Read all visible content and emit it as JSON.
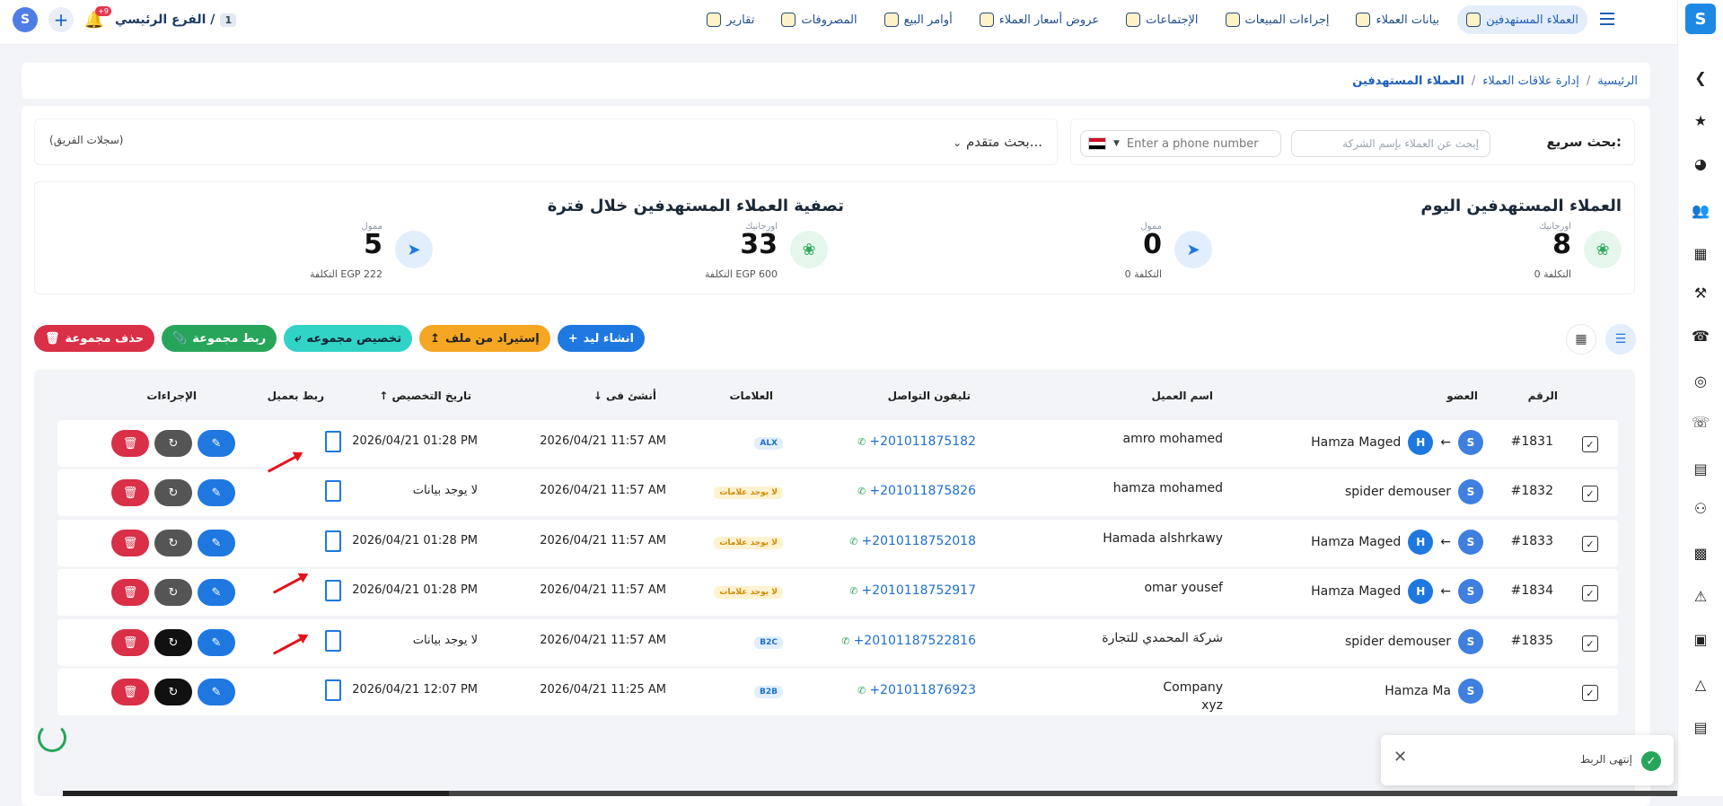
{
  "nav": {
    "items": [
      {
        "label": "العملاء المستهدفين",
        "icon": "target-users-icon",
        "active": true
      },
      {
        "label": "بيانات العملاء",
        "icon": "user-badge-icon"
      },
      {
        "label": "إجراءات المبيعات",
        "icon": "phone-icon"
      },
      {
        "label": "الإجتماعات",
        "icon": "presentation-icon"
      },
      {
        "label": "عروض أسعار العملاء",
        "icon": "document-icon"
      },
      {
        "label": "أوامر البيع",
        "icon": "money-bag-icon"
      },
      {
        "label": "المصروفات",
        "icon": "monitor-icon"
      },
      {
        "label": "تقارير",
        "icon": "report-icon"
      }
    ]
  },
  "header": {
    "notifications_count": "+9",
    "branch_number": "1",
    "branch_name": "الفرع الرئيسي /"
  },
  "breadcrumb": {
    "home": "الرئيسية",
    "section": "إدارة علاقات العملاء",
    "current": "العملاء المستهدفين"
  },
  "search": {
    "label": "بحث سريع:",
    "company_placeholder": "إبحث عن العملاء بإسم الشركة",
    "phone_placeholder": "Enter a phone number",
    "advanced_label": "بحث متقدم...",
    "team_records": "(سجلات الفريق)"
  },
  "stats": {
    "today_title": "العملاء المستهدفين اليوم",
    "period_title": "تصفية العملاء المستهدفين خلال فترة",
    "blocks": [
      {
        "sub": "اورجانيك",
        "value": "8",
        "cost": "التكلفة 0"
      },
      {
        "sub": "ممول",
        "value": "0",
        "cost": "التكلفة 0"
      },
      {
        "sub": "اورجانيك",
        "value": "33",
        "cost": "التكلفة EGP 600"
      },
      {
        "sub": "ممول",
        "value": "5",
        "cost": "التكلفة EGP 222"
      }
    ]
  },
  "actions": {
    "create_lead": "انشاء ليد",
    "import_file": "إستيراد من ملف",
    "assign_group": "تخصيص مجموعه",
    "link_group": "ربط مجموعة",
    "delete_group": "حذف مجموعة"
  },
  "table": {
    "headers": {
      "number": "الرقم",
      "member": "العضو",
      "client_name": "اسم العميل",
      "phone": "تليفون التواصل",
      "tags": "العلامات",
      "created_at": "أنشئ فى",
      "assigned_at": "تاريخ التخصيص",
      "link_client": "ربط بعميل",
      "actions": "الإجراءات"
    },
    "rows": [
      {
        "num": "#1831",
        "from": "",
        "member": "Hamza Maged",
        "client": "amro mohamed",
        "client2": "",
        "phone": "+201011875182",
        "tag": "ALX",
        "tag_color": "blue",
        "created": "2026/04/21 11:57 AM",
        "assigned": "2026/04/21 01:28 PM",
        "transfer": true
      },
      {
        "num": "#1832",
        "from": "",
        "member": "spider demouser",
        "client": "hamza mohamed",
        "client2": "",
        "phone": "+201011875826",
        "tag": "لا يوجد علامات",
        "tag_color": "yellow",
        "created": "2026/04/21 11:57 AM",
        "assigned": "لا يوجد بيانات",
        "transfer": false
      },
      {
        "num": "#1833",
        "from": "",
        "member": "Hamza Maged",
        "client": "Hamada alshrkawy",
        "client2": "",
        "phone": "+2010118752018",
        "tag": "لا يوجد علامات",
        "tag_color": "yellow",
        "created": "2026/04/21 11:57 AM",
        "assigned": "2026/04/21 01:28 PM",
        "transfer": true
      },
      {
        "num": "#1834",
        "from": "",
        "member": "Hamza Maged",
        "client": "omar yousef",
        "client2": "",
        "phone": "+2010118752917",
        "tag": "لا يوجد علامات",
        "tag_color": "yellow",
        "created": "2026/04/21 11:57 AM",
        "assigned": "2026/04/21 01:28 PM",
        "transfer": true
      },
      {
        "num": "#1835",
        "from": "",
        "member": "spider demouser",
        "client": "شركة المحمدي للتجارة",
        "client2": "",
        "phone": "+20101187522816",
        "tag": "B2C",
        "tag_color": "blue",
        "created": "2026/04/21 11:57 AM",
        "assigned": "لا يوجد بيانات",
        "transfer": false
      },
      {
        "num": "",
        "from": "",
        "member": "Hamza Ma",
        "client": "Company",
        "client2": "xyz",
        "phone": "+201011876923",
        "tag": "B2B",
        "tag_color": "blue",
        "created": "2026/04/21 11:25 AM",
        "assigned": "2026/04/21 12:07 PM",
        "transfer": false
      }
    ]
  },
  "toast": {
    "message": "إنتهى الربط"
  },
  "colors": {
    "primary": "#1e78e0",
    "danger": "#d92f47",
    "success": "#27a55a",
    "warning": "#f5a623",
    "teal": "#32d3c7"
  }
}
